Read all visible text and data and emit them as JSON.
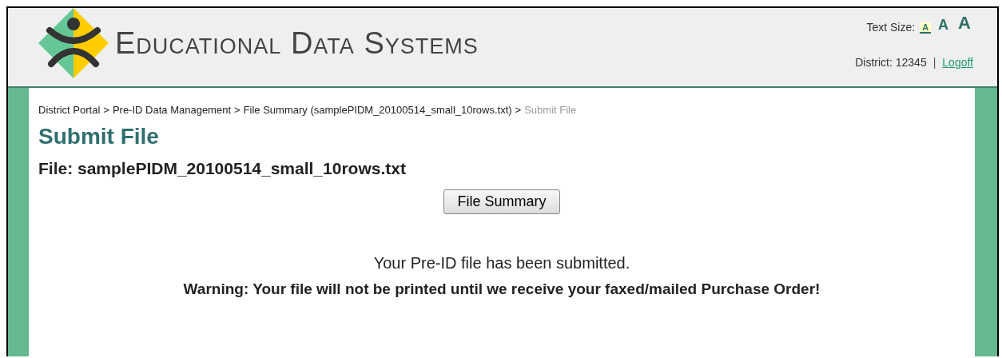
{
  "header": {
    "brand": "Educational Data Systems",
    "text_size": {
      "label": "Text Size:",
      "options": [
        {
          "label": "A",
          "selected": true
        },
        {
          "label": "A",
          "selected": false
        },
        {
          "label": "A",
          "selected": false
        }
      ]
    },
    "district": "District: 12345",
    "separator": "|",
    "logoff": "Logoff"
  },
  "breadcrumbs": [
    {
      "label": "District Portal",
      "current": false
    },
    {
      "label": "Pre-ID Data Management",
      "current": false
    },
    {
      "label": "File Summary (samplePIDM_20100514_small_10rows.txt)",
      "current": false
    },
    {
      "label": "Submit File",
      "current": true
    }
  ],
  "breadcrumb_separator": ">",
  "title": "Submit File",
  "file_heading": "File: samplePIDM_20100514_small_10rows.txt",
  "button": "File Summary",
  "message": "Your Pre-ID file has been submitted.",
  "warning": "Warning: Your file will not be printed until we receive your faxed/mailed Purchase Order!"
}
